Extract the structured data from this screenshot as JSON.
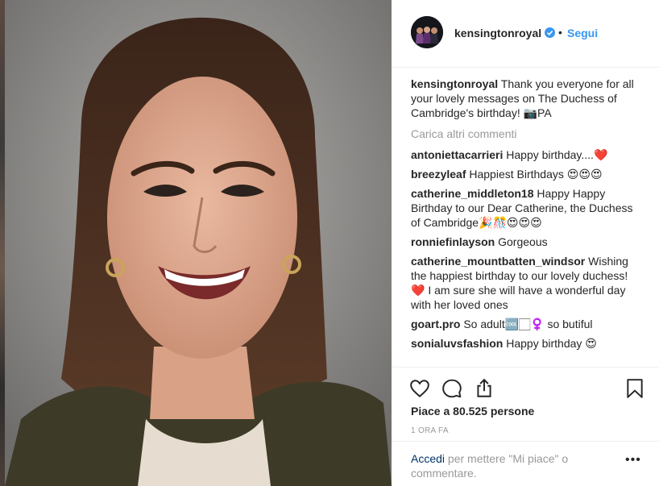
{
  "post": {
    "username": "kensingtonroyal",
    "dot": "•",
    "follow_label": "Segui",
    "verified_icon": "verified-badge-icon",
    "caption_user": "kensingtonroyal",
    "caption_text": "Thank you everyone for all your lovely messages on The Duchess of Cambridge's birthday! 📷PA",
    "load_more": "Carica altri commenti",
    "comments": [
      {
        "user": "antoniettacarrieri",
        "text": "Happy birthday....❤️"
      },
      {
        "user": "breezyleaf",
        "text": "Happiest Birthdays 😍😍😍"
      },
      {
        "user": "catherine_middleton18",
        "text": "Happy Happy Birthday to our Dear Catherine, the Duchess of Cambridge🎉🎊😍😍😍"
      },
      {
        "user": "ronniefinlayson",
        "text": "Gorgeous"
      },
      {
        "user": "catherine_mountbatten_windsor",
        "text": "Wishing the happiest birthday to our lovely duchess! ❤️ I am sure she will have a wonderful day with her loved ones"
      },
      {
        "user": "goart.pro",
        "text": "So adult🆒🏻‍♀️ so butiful"
      },
      {
        "user": "sonialuvsfashion",
        "text": "Happy birthday 😍"
      }
    ],
    "likes": "Piace a 80.525 persone",
    "time": "1 ORA FA",
    "login_link": "Accedi",
    "login_rest": " per mettere \"Mi piace\" o commentare.",
    "more_dots": "•••"
  },
  "icons": [
    "heart-icon",
    "comment-icon",
    "share-icon",
    "bookmark-icon"
  ],
  "colors": {
    "accent": "#3897f0",
    "text": "#262626",
    "muted": "#999999",
    "link": "#003569"
  }
}
